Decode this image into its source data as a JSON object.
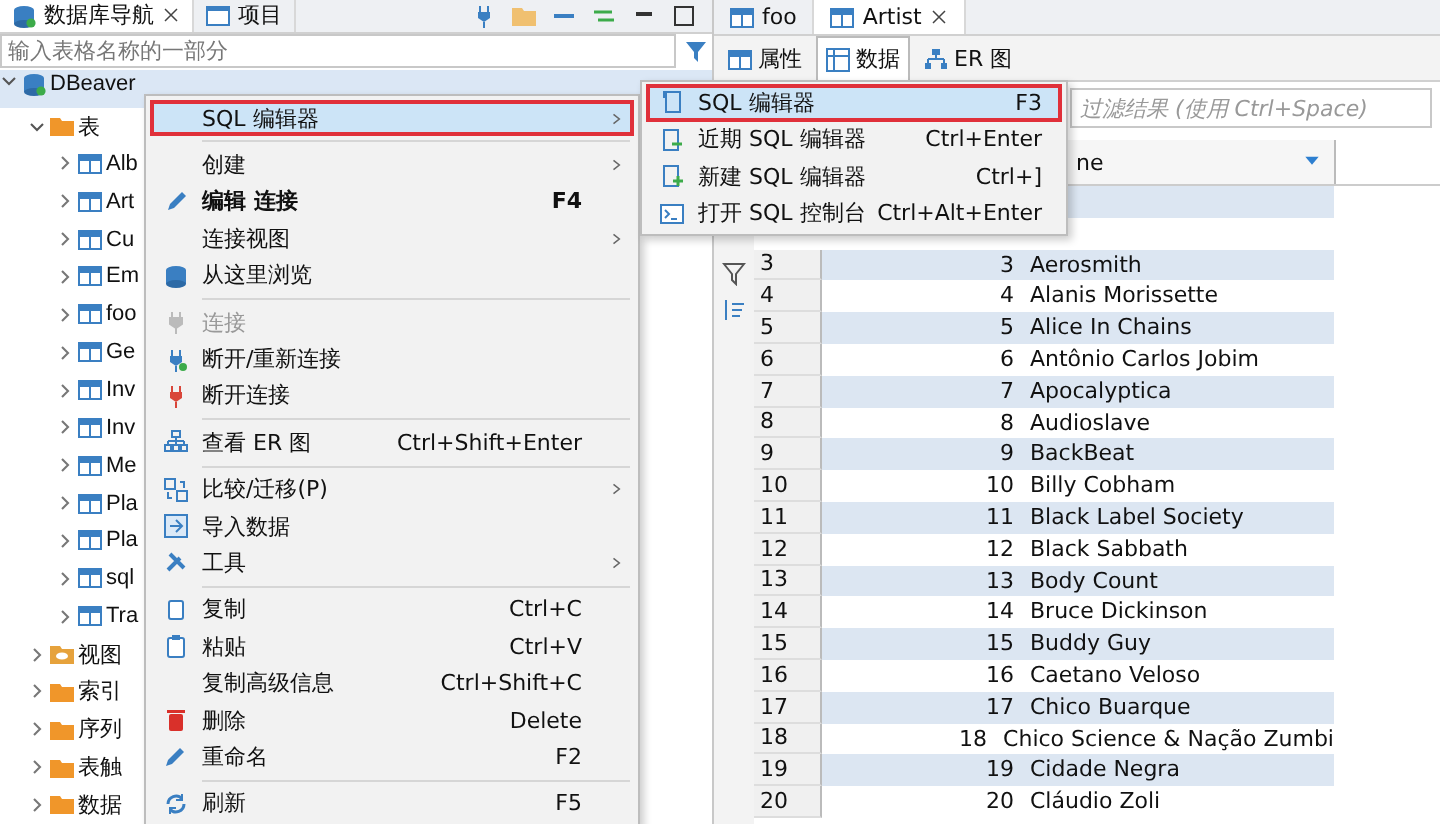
{
  "left_tabs": [
    {
      "label": "数据库导航",
      "selected": true,
      "closable": true
    },
    {
      "label": "项目",
      "selected": false,
      "closable": false
    }
  ],
  "search": {
    "placeholder": "输入表格名称的一部分"
  },
  "tree": [
    {
      "label": "DBeaver",
      "kind": "database",
      "expanded": true,
      "children": [
        {
          "label": "表",
          "kind": "folder",
          "expanded": true,
          "children": [
            {
              "label": "Alb",
              "kind": "table",
              "expanded": false
            },
            {
              "label": "Art",
              "kind": "table",
              "expanded": false
            },
            {
              "label": "Cu",
              "kind": "table",
              "expanded": false
            },
            {
              "label": "Em",
              "kind": "table",
              "expanded": false
            },
            {
              "label": "foo",
              "kind": "table",
              "expanded": false
            },
            {
              "label": "Ge",
              "kind": "table",
              "expanded": false
            },
            {
              "label": "Inv",
              "kind": "table",
              "expanded": false
            },
            {
              "label": "Inv",
              "kind": "table",
              "expanded": false
            },
            {
              "label": "Me",
              "kind": "table",
              "expanded": false
            },
            {
              "label": "Pla",
              "kind": "table",
              "expanded": false
            },
            {
              "label": "Pla",
              "kind": "table",
              "expanded": false
            },
            {
              "label": "sql",
              "kind": "table",
              "expanded": false
            },
            {
              "label": "Tra",
              "kind": "table",
              "expanded": false
            }
          ]
        },
        {
          "label": "视图",
          "kind": "view",
          "expanded": false
        },
        {
          "label": "索引",
          "kind": "folder",
          "expanded": false
        },
        {
          "label": "序列",
          "kind": "folder",
          "expanded": false
        },
        {
          "label": "表触",
          "kind": "folder",
          "expanded": false
        },
        {
          "label": "数据",
          "kind": "folder",
          "expanded": false
        }
      ]
    }
  ],
  "editor_tabs": [
    {
      "label": "foo",
      "selected": false,
      "closable": false
    },
    {
      "label": "Artist",
      "selected": true,
      "closable": true
    }
  ],
  "sub_tabs": [
    {
      "label": "属性",
      "selected": false
    },
    {
      "label": "数据",
      "selected": true
    },
    {
      "label": "ER 图",
      "selected": false
    }
  ],
  "filter": {
    "placeholder": "过滤结果 (使用 Ctrl+Space)"
  },
  "grid": {
    "column_header": "ne",
    "rows": [
      {
        "number": "3",
        "id": "3",
        "name": "Aerosmith"
      },
      {
        "number": "4",
        "id": "4",
        "name": "Alanis Morissette"
      },
      {
        "number": "5",
        "id": "5",
        "name": "Alice In Chains"
      },
      {
        "number": "6",
        "id": "6",
        "name": "Antônio Carlos Jobim"
      },
      {
        "number": "7",
        "id": "7",
        "name": "Apocalyptica"
      },
      {
        "number": "8",
        "id": "8",
        "name": "Audioslave"
      },
      {
        "number": "9",
        "id": "9",
        "name": "BackBeat"
      },
      {
        "number": "10",
        "id": "10",
        "name": "Billy Cobham"
      },
      {
        "number": "11",
        "id": "11",
        "name": "Black Label Society"
      },
      {
        "number": "12",
        "id": "12",
        "name": "Black Sabbath"
      },
      {
        "number": "13",
        "id": "13",
        "name": "Body Count"
      },
      {
        "number": "14",
        "id": "14",
        "name": "Bruce Dickinson"
      },
      {
        "number": "15",
        "id": "15",
        "name": "Buddy Guy"
      },
      {
        "number": "16",
        "id": "16",
        "name": "Caetano Veloso"
      },
      {
        "number": "17",
        "id": "17",
        "name": "Chico Buarque"
      },
      {
        "number": "18",
        "id": "18",
        "name": "Chico Science & Nação Zumbi"
      },
      {
        "number": "19",
        "id": "19",
        "name": "Cidade Negra"
      },
      {
        "number": "20",
        "id": "20",
        "name": "Cláudio Zoli"
      }
    ]
  },
  "context_menu": [
    {
      "kind": "item",
      "label": "SQL 编辑器",
      "highlighted": true,
      "submenu": true
    },
    {
      "kind": "separator"
    },
    {
      "kind": "item",
      "label": "创建",
      "submenu": true
    },
    {
      "kind": "item",
      "label": "编辑 连接",
      "shortcut": "F4",
      "bold": true
    },
    {
      "kind": "item",
      "label": "连接视图",
      "submenu": true
    },
    {
      "kind": "item",
      "label": "从这里浏览"
    },
    {
      "kind": "separator"
    },
    {
      "kind": "item",
      "label": "连接",
      "disabled": true
    },
    {
      "kind": "item",
      "label": "断开/重新连接"
    },
    {
      "kind": "item",
      "label": "断开连接"
    },
    {
      "kind": "separator"
    },
    {
      "kind": "item",
      "label": "查看 ER 图",
      "shortcut": "Ctrl+Shift+Enter"
    },
    {
      "kind": "separator"
    },
    {
      "kind": "item",
      "label": "比较/迁移(P)",
      "submenu": true
    },
    {
      "kind": "item",
      "label": "导入数据"
    },
    {
      "kind": "item",
      "label": "工具",
      "submenu": true
    },
    {
      "kind": "separator"
    },
    {
      "kind": "item",
      "label": "复制",
      "shortcut": "Ctrl+C"
    },
    {
      "kind": "item",
      "label": "粘贴",
      "shortcut": "Ctrl+V"
    },
    {
      "kind": "item",
      "label": "复制高级信息",
      "shortcut": "Ctrl+Shift+C"
    },
    {
      "kind": "item",
      "label": "删除",
      "shortcut": "Delete"
    },
    {
      "kind": "item",
      "label": "重命名",
      "shortcut": "F2"
    },
    {
      "kind": "separator"
    },
    {
      "kind": "item",
      "label": "刷新",
      "shortcut": "F5"
    }
  ],
  "submenu": [
    {
      "label": "SQL 编辑器",
      "shortcut": "F3",
      "highlighted": true
    },
    {
      "label": "近期 SQL 编辑器",
      "shortcut": "Ctrl+Enter",
      "highlighted": false
    },
    {
      "label": "新建 SQL 编辑器",
      "shortcut": "Ctrl+]",
      "highlighted": false
    },
    {
      "label": "打开 SQL 控制台",
      "shortcut": "Ctrl+Alt+Enter",
      "highlighted": false
    }
  ]
}
